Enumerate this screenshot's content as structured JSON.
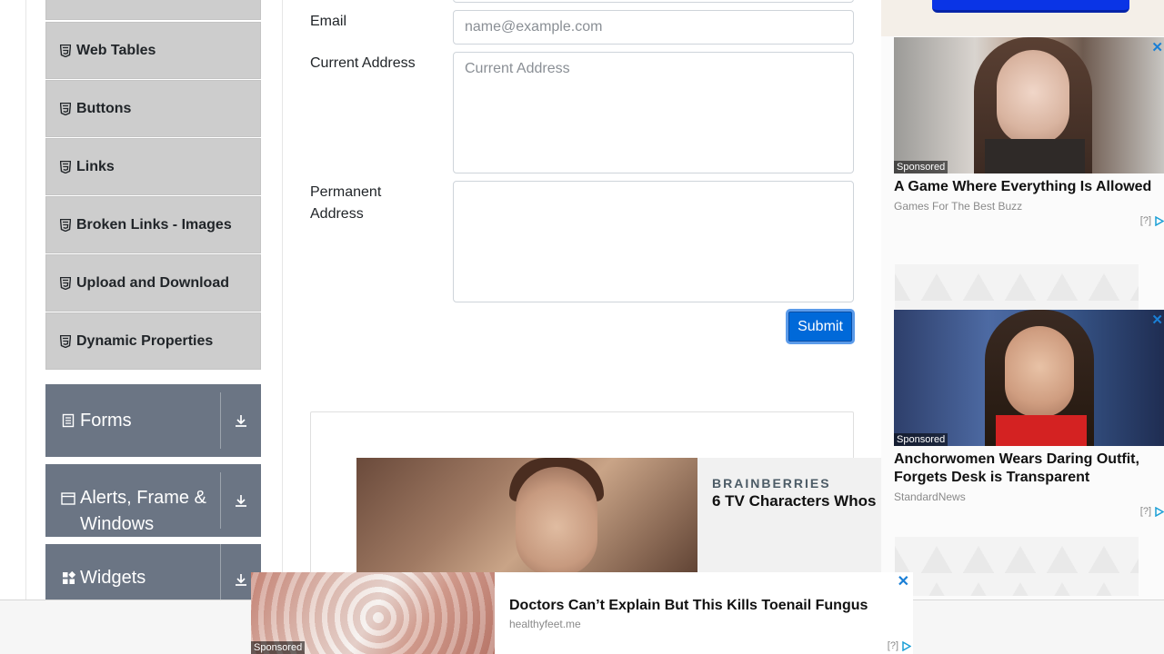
{
  "sidebar": {
    "items": [
      {
        "label": ""
      },
      {
        "label": "Web Tables"
      },
      {
        "label": "Buttons"
      },
      {
        "label": "Links"
      },
      {
        "label": "Broken Links - Images"
      },
      {
        "label": "Upload and Download"
      },
      {
        "label": "Dynamic Properties"
      }
    ],
    "groups": [
      {
        "label": "Forms",
        "icon": "form-icon"
      },
      {
        "label": "Alerts, Frame & Windows",
        "icon": "window-icon"
      },
      {
        "label": "Widgets",
        "icon": "widgets-icon"
      }
    ]
  },
  "form": {
    "email_label": "Email",
    "email_placeholder": "name@example.com",
    "current_address_label": "Current Address",
    "current_address_placeholder": "Current Address",
    "permanent_address_label": "Permanent Address",
    "submit_label": "Submit"
  },
  "ads": {
    "brainberries": {
      "brand": "BRAINBERRIES",
      "title": "6 TV Characters Whos"
    },
    "right_cards": [
      {
        "sponsored": "Sponsored",
        "title": "A Game Where Everything Is Allowed",
        "source": "Games For The Best Buzz",
        "adchoice": "[?]"
      },
      {
        "sponsored": "Sponsored",
        "title": "Anchorwomen Wears Daring Outfit, Forgets Desk is Transparent",
        "source": "StandardNews",
        "adchoice": "[?]"
      }
    ],
    "bottom": {
      "sponsored": "Sponsored",
      "title": "Doctors Can’t Explain But This Kills Toenail Fungus",
      "source": "healthyfeet.me",
      "adchoice": "[?]"
    }
  },
  "colors": {
    "accent": "#0069d9",
    "group_header": "#6b7584",
    "menu_item": "#cdcdcd"
  }
}
